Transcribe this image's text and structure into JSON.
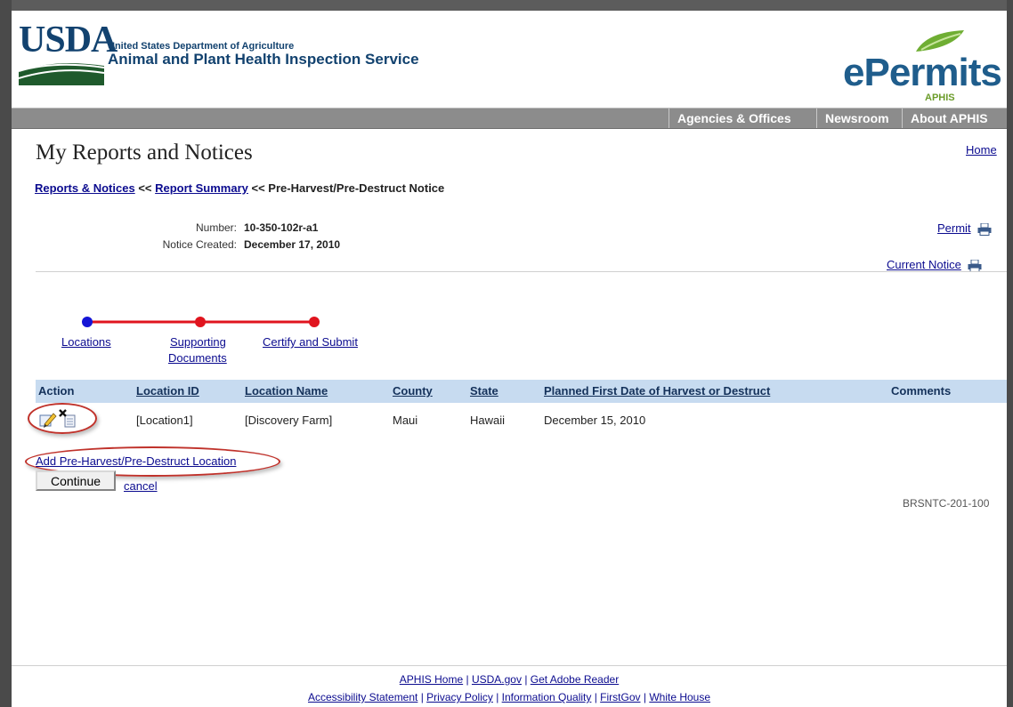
{
  "header": {
    "usda_logo": "USDA",
    "agency_small": "United States Department of Agriculture",
    "agency_name": "Animal and Plant Health Inspection Service",
    "epermits_logo": "ePermits",
    "epermits_sub": "APHIS"
  },
  "nav": {
    "agencies": "Agencies & Offices",
    "newsroom": "Newsroom",
    "about": "About APHIS"
  },
  "page": {
    "title": "My Reports and Notices",
    "home_link": "Home"
  },
  "breadcrumb": {
    "reports": "Reports & Notices",
    "sep1": " << ",
    "summary": "Report Summary",
    "sep2": " << ",
    "current": "Pre-Harvest/Pre-Destruct Notice"
  },
  "notice": {
    "number_label": "Number:",
    "number_value": "10-350-102r-a1",
    "created_label": "Notice Created:",
    "created_value": "December 17, 2010",
    "permit_link": "Permit",
    "current_notice_link": "Current Notice"
  },
  "progress": {
    "steps": [
      "Locations",
      "Supporting",
      "Documents",
      "Certify and Submit"
    ],
    "colors": {
      "done": "#1515d6",
      "active": "#e0141e",
      "line": "#e0141e"
    }
  },
  "table": {
    "headers": {
      "action": "Action",
      "location_id": "Location ID",
      "location_name": "Location Name",
      "county": "County",
      "state": "State",
      "planned_date": "Planned First Date of Harvest or Destruct",
      "comments": "Comments"
    },
    "rows": [
      {
        "location_id": "[Location1]",
        "location_name": "[Discovery Farm]",
        "county": "Maui",
        "state": "Hawaii",
        "planned_date": "December 15, 2010",
        "comments": ""
      }
    ]
  },
  "actions": {
    "add_location": "Add Pre-Harvest/Pre-Destruct Location",
    "continue": "Continue",
    "cancel": "cancel",
    "form_code": "BRSNTC-201-100"
  },
  "footer": {
    "line1": [
      "APHIS Home",
      "USDA.gov",
      "Get Adobe Reader"
    ],
    "line2": [
      "Accessibility Statement",
      "Privacy Policy",
      "Information Quality",
      "FirstGov",
      "White House"
    ],
    "separator": " | "
  },
  "colors": {
    "header_blue": "#12426f",
    "nav_gray": "#8c8c8c",
    "table_header": "#c7dbf0",
    "link": "#0b0b8f",
    "highlight_oval": "#c0322b"
  }
}
